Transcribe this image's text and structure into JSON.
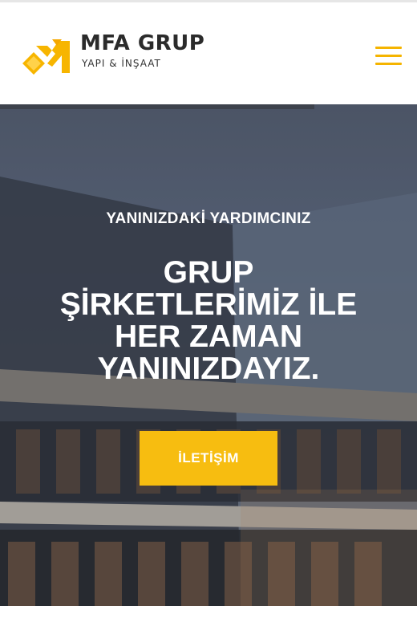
{
  "header": {
    "brand": "MFA GRUP",
    "tagline": "YAPI & İNŞAAT",
    "logo_icon": "mfa-m-diamond-logo",
    "menu_icon": "hamburger-icon"
  },
  "hero": {
    "subtitle": "YANINIZDAKİ YARDIMCINIZ",
    "title_lines": [
      "GRUP",
      "ŞİRKETLERİMİZ İLE",
      "HER ZAMAN",
      "YANINIZDAYIZ."
    ],
    "cta_label": "İLETİŞİM"
  },
  "colors": {
    "accent": "#f7bd10",
    "menu": "#f5b400",
    "brand_text": "#2b2b2b",
    "hero_text": "#ffffff"
  }
}
